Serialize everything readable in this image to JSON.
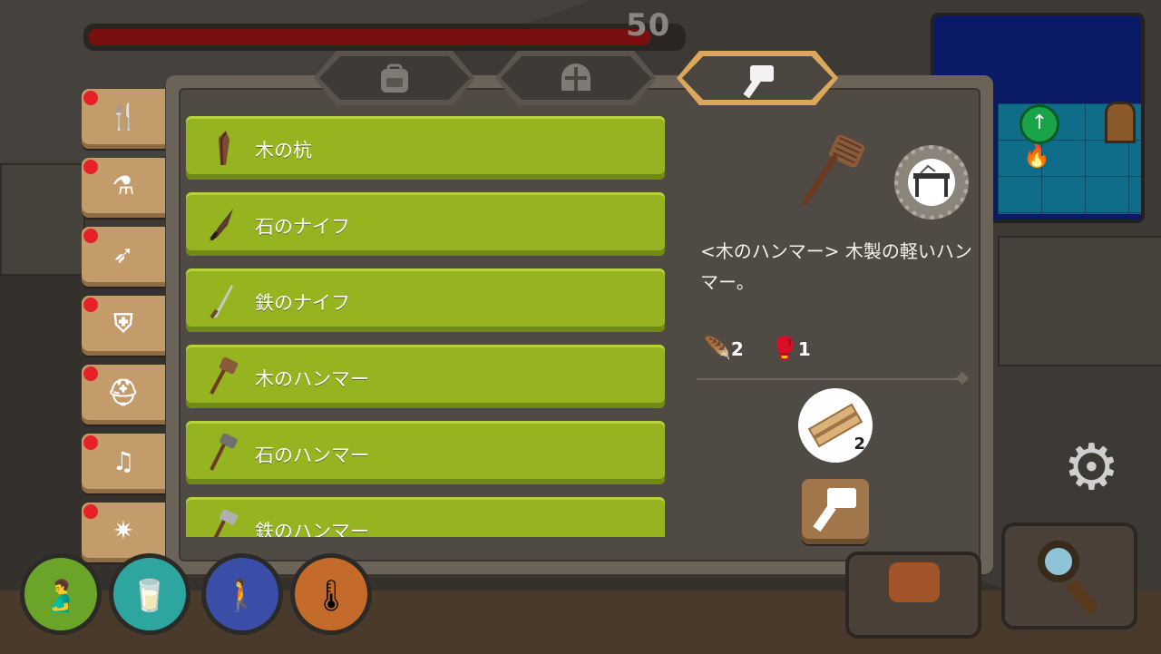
{
  "hud": {
    "hp_value": "50",
    "hp_fraction": 0.95
  },
  "tabs": [
    {
      "icon": "backpack-icon",
      "active": false
    },
    {
      "icon": "helmet-icon",
      "active": false
    },
    {
      "icon": "hammer-icon",
      "active": true
    }
  ],
  "recipes": [
    {
      "label": "木の杭",
      "icon": "wood-stake-icon"
    },
    {
      "label": "石のナイフ",
      "icon": "stone-knife-icon"
    },
    {
      "label": "鉄のナイフ",
      "icon": "iron-knife-icon"
    },
    {
      "label": "木のハンマー",
      "icon": "wood-hammer-icon"
    },
    {
      "label": "石のハンマー",
      "icon": "stone-hammer-icon"
    },
    {
      "label": "鉄のハンマー",
      "icon": "iron-hammer-icon"
    }
  ],
  "detail": {
    "description": "<木のハンマー> 木製の軽いハンマー。",
    "stats": [
      {
        "icon": "feather-icon",
        "value": "2",
        "color": "#3aa0ff"
      },
      {
        "icon": "boxing-glove-icon",
        "value": "1",
        "color": "#e0405a"
      }
    ],
    "material": {
      "icon": "wood-planks-icon",
      "qty": "2"
    },
    "craft_icon": "hammer-icon",
    "station_icon": "workbench-icon"
  },
  "side_menu": [
    {
      "icon": "utensils-icon",
      "glyph": "🍴"
    },
    {
      "icon": "potion-icon",
      "glyph": "⚗"
    },
    {
      "icon": "bow-icon",
      "glyph": "➶"
    },
    {
      "icon": "shield-icon",
      "glyph": "⛨"
    },
    {
      "icon": "helmet-icon",
      "glyph": "⛑"
    },
    {
      "icon": "music-icon",
      "glyph": "♫"
    },
    {
      "icon": "sparkle-icon",
      "glyph": "✷"
    }
  ],
  "status": [
    {
      "icon": "stomach-icon",
      "color": "#6aa52a"
    },
    {
      "icon": "water-glass-icon",
      "color": "#2ea6a0"
    },
    {
      "icon": "stamina-icon",
      "color": "#3a4ea8"
    },
    {
      "icon": "thermometer-icon",
      "color": "#c46a2a"
    }
  ]
}
